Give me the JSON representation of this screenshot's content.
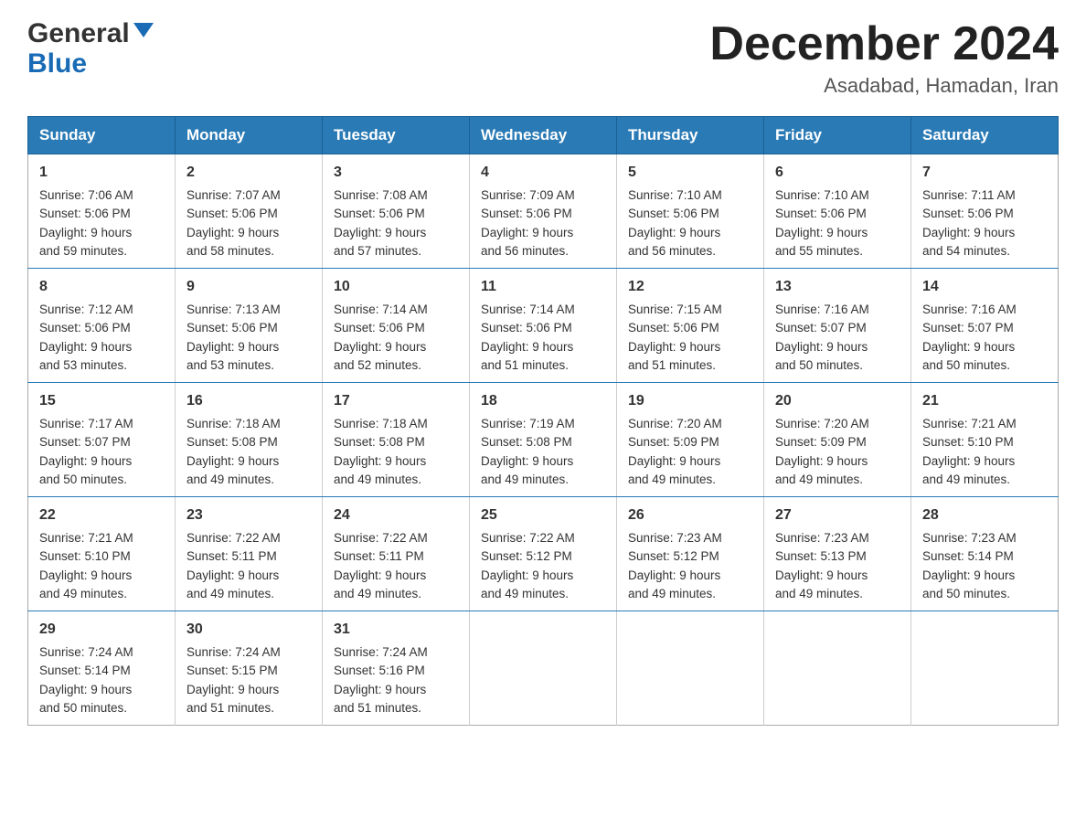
{
  "header": {
    "logo_general": "General",
    "logo_blue": "Blue",
    "month_title": "December 2024",
    "subtitle": "Asadabad, Hamadan, Iran"
  },
  "days_of_week": [
    "Sunday",
    "Monday",
    "Tuesday",
    "Wednesday",
    "Thursday",
    "Friday",
    "Saturday"
  ],
  "weeks": [
    [
      {
        "num": "1",
        "sunrise": "7:06 AM",
        "sunset": "5:06 PM",
        "daylight": "9 hours and 59 minutes."
      },
      {
        "num": "2",
        "sunrise": "7:07 AM",
        "sunset": "5:06 PM",
        "daylight": "9 hours and 58 minutes."
      },
      {
        "num": "3",
        "sunrise": "7:08 AM",
        "sunset": "5:06 PM",
        "daylight": "9 hours and 57 minutes."
      },
      {
        "num": "4",
        "sunrise": "7:09 AM",
        "sunset": "5:06 PM",
        "daylight": "9 hours and 56 minutes."
      },
      {
        "num": "5",
        "sunrise": "7:10 AM",
        "sunset": "5:06 PM",
        "daylight": "9 hours and 56 minutes."
      },
      {
        "num": "6",
        "sunrise": "7:10 AM",
        "sunset": "5:06 PM",
        "daylight": "9 hours and 55 minutes."
      },
      {
        "num": "7",
        "sunrise": "7:11 AM",
        "sunset": "5:06 PM",
        "daylight": "9 hours and 54 minutes."
      }
    ],
    [
      {
        "num": "8",
        "sunrise": "7:12 AM",
        "sunset": "5:06 PM",
        "daylight": "9 hours and 53 minutes."
      },
      {
        "num": "9",
        "sunrise": "7:13 AM",
        "sunset": "5:06 PM",
        "daylight": "9 hours and 53 minutes."
      },
      {
        "num": "10",
        "sunrise": "7:14 AM",
        "sunset": "5:06 PM",
        "daylight": "9 hours and 52 minutes."
      },
      {
        "num": "11",
        "sunrise": "7:14 AM",
        "sunset": "5:06 PM",
        "daylight": "9 hours and 51 minutes."
      },
      {
        "num": "12",
        "sunrise": "7:15 AM",
        "sunset": "5:06 PM",
        "daylight": "9 hours and 51 minutes."
      },
      {
        "num": "13",
        "sunrise": "7:16 AM",
        "sunset": "5:07 PM",
        "daylight": "9 hours and 50 minutes."
      },
      {
        "num": "14",
        "sunrise": "7:16 AM",
        "sunset": "5:07 PM",
        "daylight": "9 hours and 50 minutes."
      }
    ],
    [
      {
        "num": "15",
        "sunrise": "7:17 AM",
        "sunset": "5:07 PM",
        "daylight": "9 hours and 50 minutes."
      },
      {
        "num": "16",
        "sunrise": "7:18 AM",
        "sunset": "5:08 PM",
        "daylight": "9 hours and 49 minutes."
      },
      {
        "num": "17",
        "sunrise": "7:18 AM",
        "sunset": "5:08 PM",
        "daylight": "9 hours and 49 minutes."
      },
      {
        "num": "18",
        "sunrise": "7:19 AM",
        "sunset": "5:08 PM",
        "daylight": "9 hours and 49 minutes."
      },
      {
        "num": "19",
        "sunrise": "7:20 AM",
        "sunset": "5:09 PM",
        "daylight": "9 hours and 49 minutes."
      },
      {
        "num": "20",
        "sunrise": "7:20 AM",
        "sunset": "5:09 PM",
        "daylight": "9 hours and 49 minutes."
      },
      {
        "num": "21",
        "sunrise": "7:21 AM",
        "sunset": "5:10 PM",
        "daylight": "9 hours and 49 minutes."
      }
    ],
    [
      {
        "num": "22",
        "sunrise": "7:21 AM",
        "sunset": "5:10 PM",
        "daylight": "9 hours and 49 minutes."
      },
      {
        "num": "23",
        "sunrise": "7:22 AM",
        "sunset": "5:11 PM",
        "daylight": "9 hours and 49 minutes."
      },
      {
        "num": "24",
        "sunrise": "7:22 AM",
        "sunset": "5:11 PM",
        "daylight": "9 hours and 49 minutes."
      },
      {
        "num": "25",
        "sunrise": "7:22 AM",
        "sunset": "5:12 PM",
        "daylight": "9 hours and 49 minutes."
      },
      {
        "num": "26",
        "sunrise": "7:23 AM",
        "sunset": "5:12 PM",
        "daylight": "9 hours and 49 minutes."
      },
      {
        "num": "27",
        "sunrise": "7:23 AM",
        "sunset": "5:13 PM",
        "daylight": "9 hours and 49 minutes."
      },
      {
        "num": "28",
        "sunrise": "7:23 AM",
        "sunset": "5:14 PM",
        "daylight": "9 hours and 50 minutes."
      }
    ],
    [
      {
        "num": "29",
        "sunrise": "7:24 AM",
        "sunset": "5:14 PM",
        "daylight": "9 hours and 50 minutes."
      },
      {
        "num": "30",
        "sunrise": "7:24 AM",
        "sunset": "5:15 PM",
        "daylight": "9 hours and 51 minutes."
      },
      {
        "num": "31",
        "sunrise": "7:24 AM",
        "sunset": "5:16 PM",
        "daylight": "9 hours and 51 minutes."
      },
      null,
      null,
      null,
      null
    ]
  ],
  "labels": {
    "sunrise": "Sunrise:",
    "sunset": "Sunset:",
    "daylight": "Daylight:"
  }
}
